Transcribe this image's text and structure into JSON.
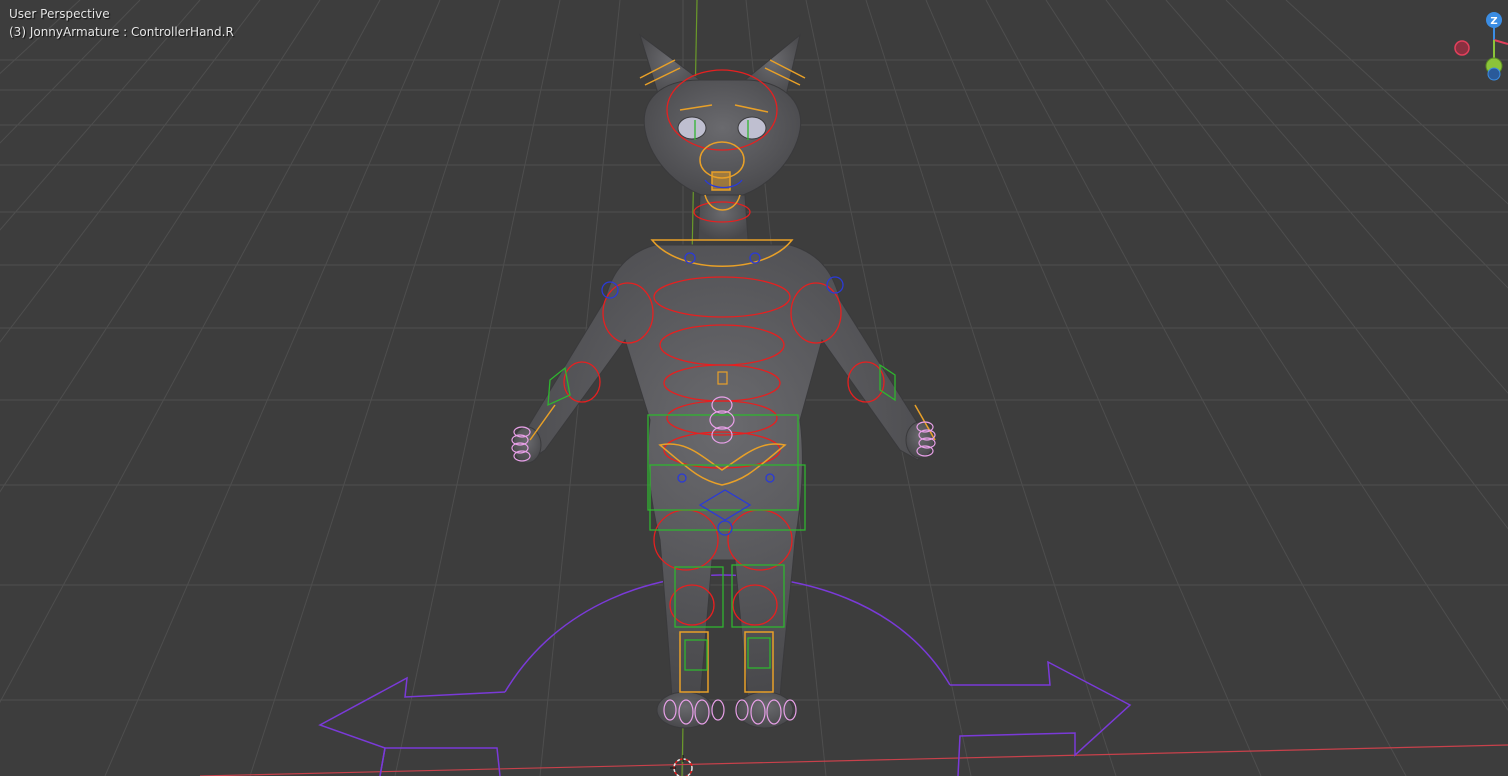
{
  "viewport": {
    "view_name": "User Perspective",
    "object_info": "(3) JonnyArmature : ControllerHand.R"
  },
  "nav_gizmo": {
    "z_label": "Z",
    "x_color": "#e3405c",
    "y_color": "#8bc43a",
    "z_color": "#3b8de3"
  },
  "colors": {
    "background": "#3d3d3d",
    "grid": "#4e4e4e",
    "x_axis": "#c8414b",
    "y_axis": "#6a9a2a",
    "mesh": "#5a5a5d",
    "bone_red": "#e62020",
    "bone_orange": "#e8a028",
    "bone_green": "#2fb52f",
    "bone_blue": "#2a3ad8",
    "bone_purple": "#7a3ad8",
    "bone_pink": "#e8a0e8"
  }
}
